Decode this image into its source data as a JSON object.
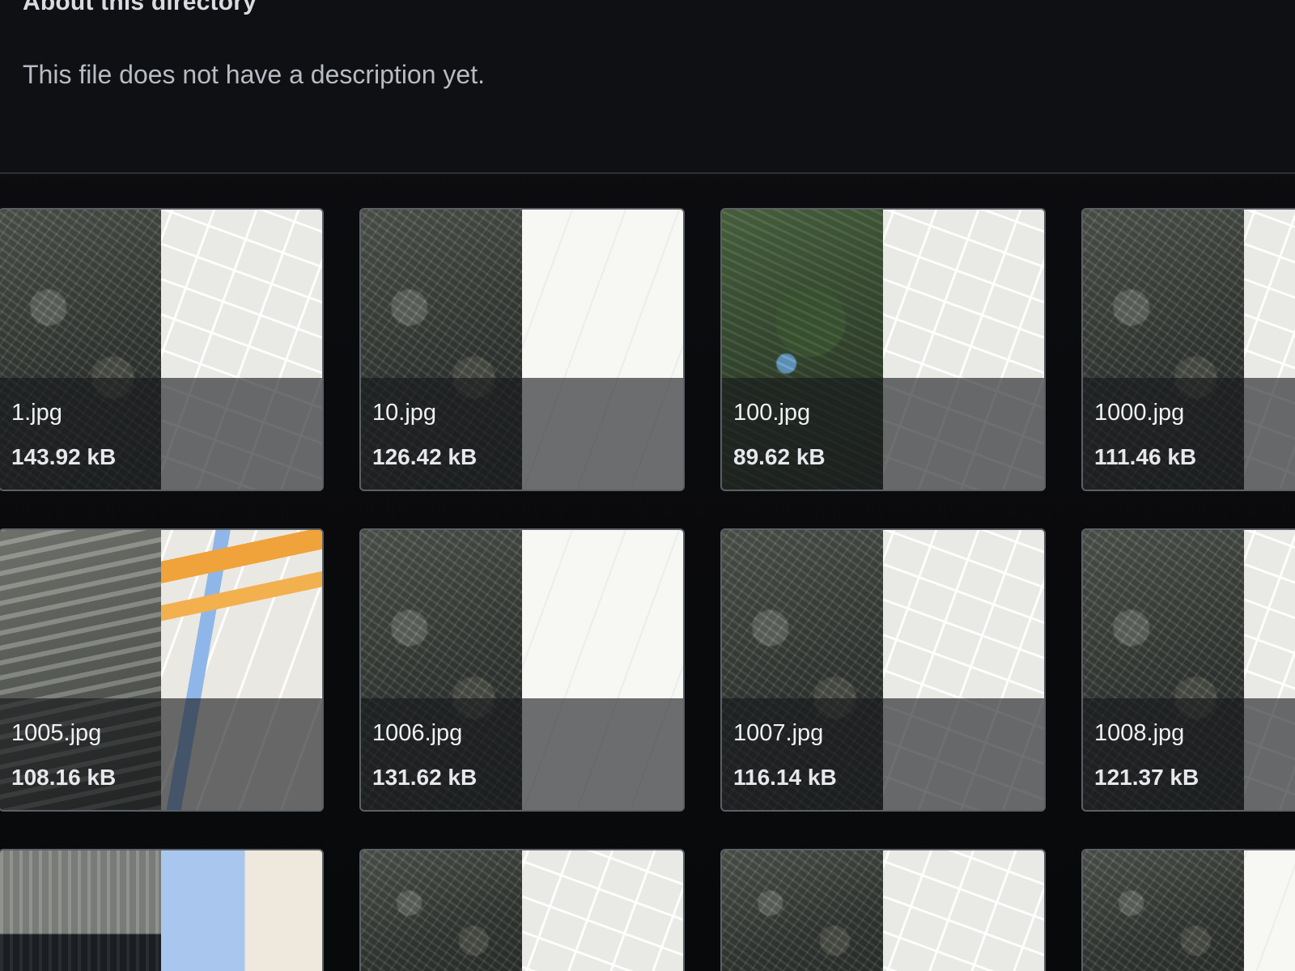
{
  "header": {
    "title": "About this directory",
    "description": "This file does not have a description yet."
  },
  "files": [
    {
      "name": "1.jpg",
      "size": "143.92 kB"
    },
    {
      "name": "10.jpg",
      "size": "126.42 kB"
    },
    {
      "name": "100.jpg",
      "size": "89.62 kB"
    },
    {
      "name": "1000.jpg",
      "size": "111.46 kB"
    },
    {
      "name": "1005.jpg",
      "size": "108.16 kB"
    },
    {
      "name": "1006.jpg",
      "size": "131.62 kB"
    },
    {
      "name": "1007.jpg",
      "size": "116.14 kB"
    },
    {
      "name": "1008.jpg",
      "size": "121.37 kB"
    }
  ],
  "colors": {
    "background": "#0b0c0f",
    "tile_border": "#5b5f66",
    "text_primary": "#eef0f3",
    "text_secondary": "#b7bbc3",
    "map_orange": "#f0a23b",
    "map_water": "#a9c6ee"
  }
}
